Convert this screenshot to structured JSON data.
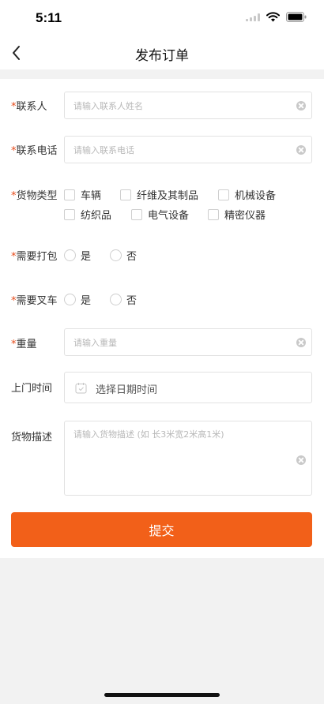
{
  "status_bar": {
    "time": "5:11"
  },
  "nav": {
    "title": "发布订单"
  },
  "form": {
    "contact": {
      "label": "联系人",
      "placeholder": "请输入联系人姓名"
    },
    "phone": {
      "label": "联系电话",
      "placeholder": "请输入联系电话"
    },
    "cargo_type": {
      "label": "货物类型",
      "options": [
        "车辆",
        "纤维及其制品",
        "机械设备",
        "纺织品",
        "电气设备",
        "精密仪器"
      ]
    },
    "packing": {
      "label": "需要打包",
      "yes": "是",
      "no": "否"
    },
    "forklift": {
      "label": "需要叉车",
      "yes": "是",
      "no": "否"
    },
    "weight": {
      "label": "重量",
      "placeholder": "请输入重量"
    },
    "visit_time": {
      "label": "上门时间",
      "value": "选择日期时间"
    },
    "description": {
      "label": "货物描述",
      "placeholder": "请输入货物描述 (如 长3米宽2米高1米)"
    },
    "required_mark": "*"
  },
  "submit": {
    "label": "提交"
  }
}
